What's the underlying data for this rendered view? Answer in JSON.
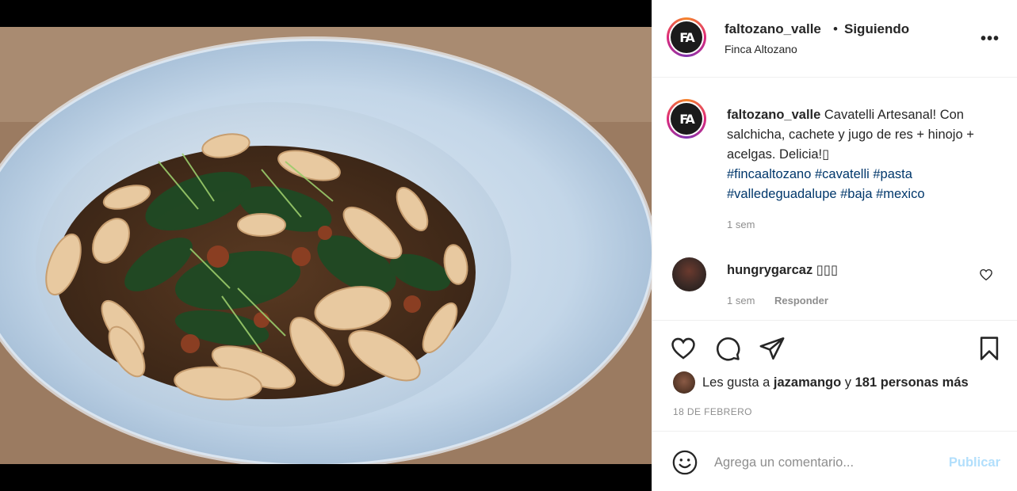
{
  "post": {
    "account": "faltozano_valle",
    "separator": "•",
    "follow_status": "Siguiendo",
    "location": "Finca Altozano",
    "avatar_initials": "FA",
    "more_glyph": "•••"
  },
  "caption": {
    "username": "faltozano_valle",
    "text": "Cavatelli Artesanal! Con salchicha, cachete y jugo de res + hinojo + acelgas. Delicia!",
    "emoji_glyph": "▯",
    "hashtags": "#fincaaltozano #cavatelli #pasta #valledeguadalupe #baja #mexico",
    "time": "1 sem"
  },
  "comment": {
    "username": "hungrygarcaz",
    "text": "▯▯▯",
    "time": "1 sem",
    "reply_label": "Responder"
  },
  "likes": {
    "prefix": "Les gusta a",
    "user": "jazamango",
    "conjunction": "y",
    "others": "181 personas más"
  },
  "date": "18 DE FEBRERO",
  "composer": {
    "placeholder": "Agrega un comentario...",
    "publish_label": "Publicar"
  },
  "icons": {
    "like": "heart-icon",
    "comment": "comment-icon",
    "share": "paper-plane-icon",
    "save": "bookmark-icon",
    "emoji": "smiley-icon",
    "more": "more-icon"
  },
  "colors": {
    "text": "#262626",
    "muted": "#8e8e8e",
    "hashtag": "#00376b",
    "publish_disabled": "#b2dffc",
    "border": "#efefef"
  }
}
